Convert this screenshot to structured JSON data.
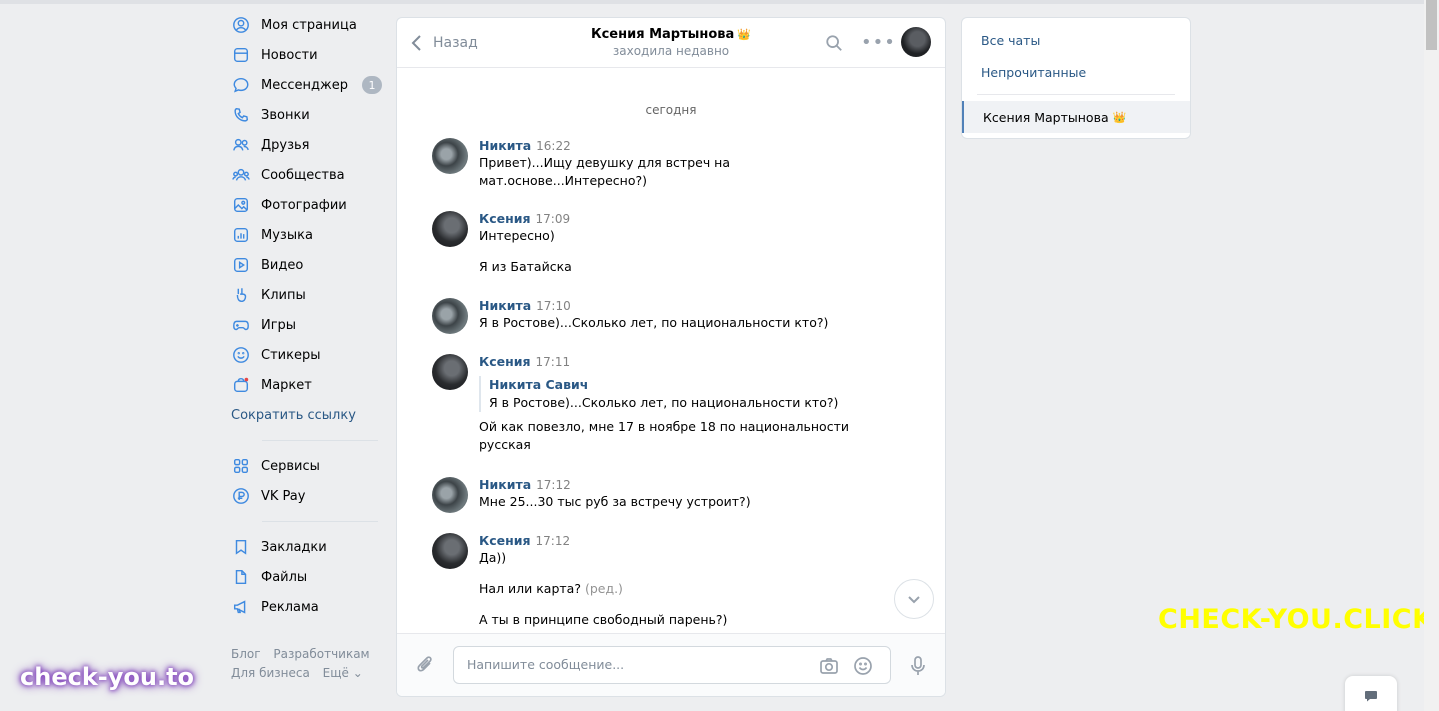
{
  "nav": {
    "items": [
      {
        "icon": "user-circle-icon",
        "label": "Моя страница"
      },
      {
        "icon": "news-icon",
        "label": "Новости"
      },
      {
        "icon": "message-icon",
        "label": "Мессенджер",
        "badge": "1"
      },
      {
        "icon": "phone-icon",
        "label": "Звонки"
      },
      {
        "icon": "friends-icon",
        "label": "Друзья"
      },
      {
        "icon": "communities-icon",
        "label": "Сообщества"
      },
      {
        "icon": "photo-icon",
        "label": "Фотографии"
      },
      {
        "icon": "music-icon",
        "label": "Музыка"
      },
      {
        "icon": "video-icon",
        "label": "Видео"
      },
      {
        "icon": "clips-icon",
        "label": "Клипы"
      },
      {
        "icon": "gamepad-icon",
        "label": "Игры"
      },
      {
        "icon": "smile-icon",
        "label": "Стикеры"
      },
      {
        "icon": "market-icon",
        "label": "Маркет"
      }
    ],
    "shorten_link": "Сократить ссылку",
    "group2": [
      {
        "icon": "services-icon",
        "label": "Сервисы"
      },
      {
        "icon": "vkpay-icon",
        "label": "VK Pay"
      }
    ],
    "group3": [
      {
        "icon": "bookmark-icon",
        "label": "Закладки"
      },
      {
        "icon": "file-icon",
        "label": "Файлы"
      },
      {
        "icon": "megaphone-icon",
        "label": "Реклама"
      }
    ],
    "footer": {
      "blog": "Блог",
      "developers": "Разработчикам",
      "business": "Для бизнеса",
      "more": "Ещё ⌄"
    }
  },
  "chat": {
    "back_label": "Назад",
    "peer_name": "Ксения Мартынова",
    "peer_crown": "👑",
    "peer_status": "заходила недавно",
    "date_separator": "сегодня",
    "messages": [
      {
        "author": "Никита",
        "time": "16:22",
        "lines": [
          "Привет)...Ищу девушку для встреч на",
          "мат.основе...Интересно?)"
        ]
      },
      {
        "author": "Ксения",
        "time": "17:09",
        "lines": [
          "Интересно)"
        ],
        "extra": [
          "Я из Батайска"
        ]
      },
      {
        "author": "Никита",
        "time": "17:10",
        "lines": [
          "Я в Ростове)...Сколько лет, по национальности кто?)"
        ]
      },
      {
        "author": "Ксения",
        "time": "17:11",
        "reply_author": "Никита Савич",
        "reply_text": "Я в Ростове)...Сколько лет, по национальности кто?)",
        "lines": [
          "Ой как повезло, мне 17 в ноябре 18 по национальности",
          "русская"
        ]
      },
      {
        "author": "Никита",
        "time": "17:12",
        "lines": [
          "Мне 25...30 тыс руб за встречу устроит?)"
        ]
      },
      {
        "author": "Ксения",
        "time": "17:12",
        "lines": [
          "Да))"
        ],
        "extra2": "Нал или карта?",
        "edited": "(ред.)",
        "extra3": "А ты в принципе свободный парень?)"
      }
    ],
    "composer_placeholder": "Напишите сообщение..."
  },
  "right_panel": {
    "all_chats": "Все чаты",
    "unread": "Непрочитанные",
    "active_chat": "Ксения Мартынова",
    "active_crown": "👑"
  },
  "watermarks": {
    "right": "CHECK-YOU.CLICK",
    "left": "check-you.to"
  },
  "colors": {
    "accent": "#2a5885",
    "icon_blue": "#3f8ae0",
    "watermark_yellow": "#ffff00"
  }
}
